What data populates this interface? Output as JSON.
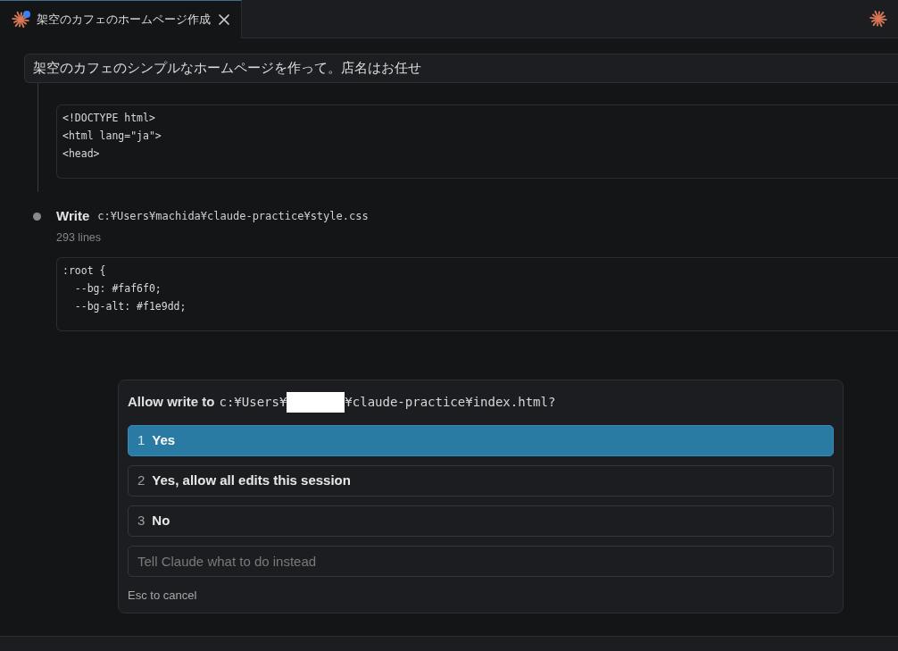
{
  "tabs": [
    {
      "title": "架空のカフェのホームページ作成",
      "selected": true,
      "dot": true
    }
  ],
  "user_message": "架空のカフェのシンプルなホームページを作って。店名はお任せ",
  "timeline": [
    {
      "code_lines": [
        "<!DOCTYPE html>",
        "<html lang=\"ja\">",
        "<head>"
      ]
    },
    {
      "tool": "Write",
      "path": "c:¥Users¥machida¥claude-practice¥style.css",
      "summary": "293 lines",
      "code_lines": [
        ":root {",
        "  --bg: #faf6f0;",
        "  --bg-alt: #f1e9dd;"
      ]
    }
  ],
  "dialog": {
    "title": "Allow write to",
    "path_start": "c:¥Users¥",
    "redacted": true,
    "path_end": "¥claude-practice¥index.html?",
    "options": [
      {
        "number": "1",
        "label": "Yes",
        "selected": true
      },
      {
        "number": "2",
        "label": "Yes, allow all edits this session",
        "selected": false
      },
      {
        "number": "3",
        "label": "No",
        "selected": false
      }
    ],
    "input": {
      "placeholder": "Tell Claude what to do instead"
    },
    "hint": "Esc to cancel"
  }
}
